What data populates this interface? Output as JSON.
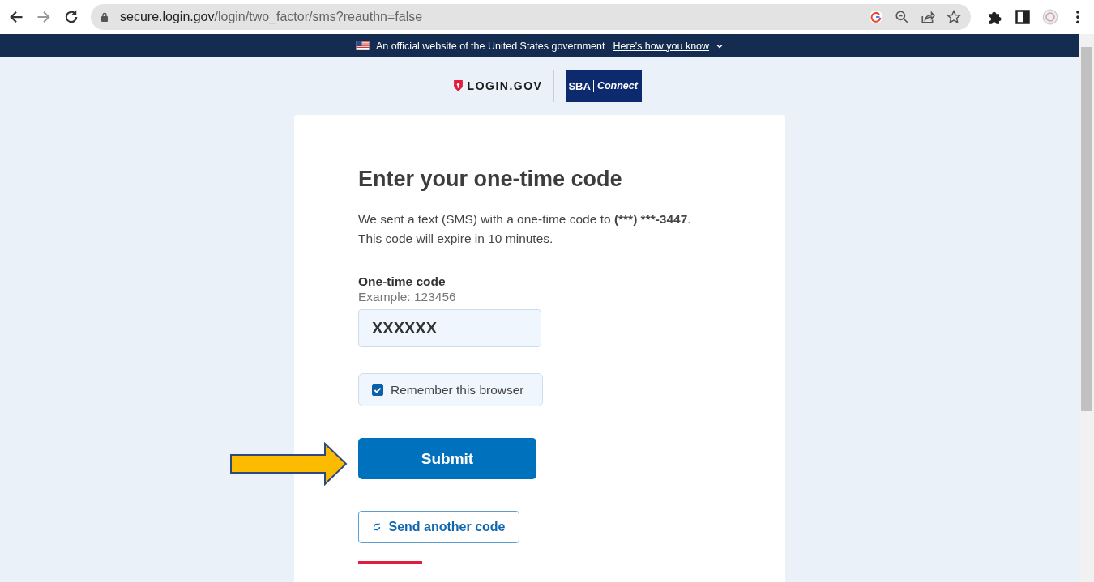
{
  "browser": {
    "url_host": "secure.login.gov",
    "url_path": "/login/two_factor/sms?reauthn=false"
  },
  "banner": {
    "text": "An official website of the United States government",
    "link": "Here’s how you know"
  },
  "logos": {
    "login": "LOGIN.GOV",
    "partner_mark": "SBA",
    "partner_name": "Connect"
  },
  "heading": "Enter your one-time code",
  "intro": {
    "before": "We sent a text (SMS) with a one-time code to ",
    "phone": "(***) ***-3447",
    "after": ".",
    "line2": "This code will expire in 10 minutes."
  },
  "code_field": {
    "label": "One-time code",
    "hint": "Example: 123456",
    "value": "XXXXXX"
  },
  "remember": {
    "label": "Remember this browser",
    "checked": true
  },
  "submit": "Submit",
  "resend": "Send another code"
}
